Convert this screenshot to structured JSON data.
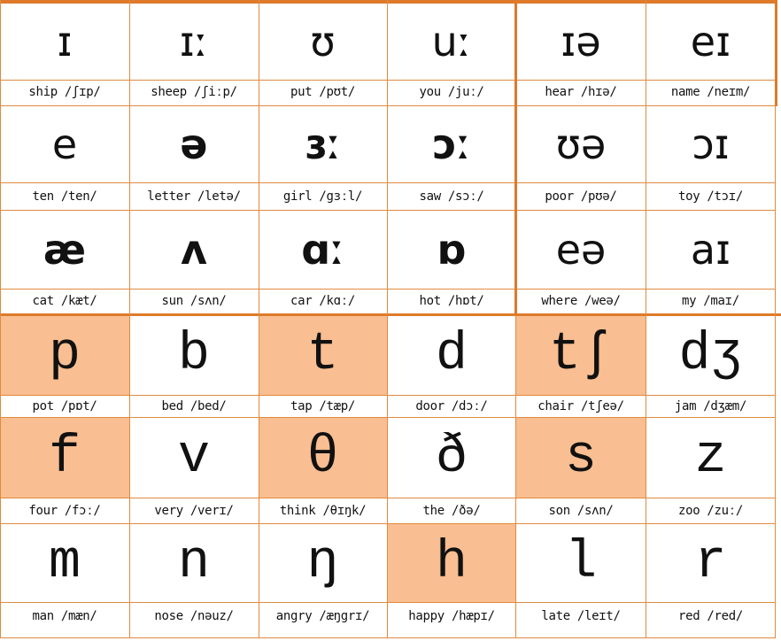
{
  "colors": {
    "grid": "#e08a40",
    "grid_thick": "#de7a2a",
    "highlight": "#f9be91",
    "text": "#111111",
    "background": "#ffffff"
  },
  "vowel_rows": [
    [
      {
        "symbol": "ɪ",
        "word": "ship",
        "ipa": "/ʃɪp/"
      },
      {
        "symbol": "ɪː",
        "word": "sheep",
        "ipa": "/ʃiːp/"
      },
      {
        "symbol": "ʊ",
        "word": "put",
        "ipa": "/pʊt/"
      },
      {
        "symbol": "uː",
        "word": "you",
        "ipa": "/juː/"
      },
      {
        "symbol": "ɪə",
        "word": "hear",
        "ipa": "/hɪə/"
      },
      {
        "symbol": "eɪ",
        "word": "name",
        "ipa": "/neɪm/"
      }
    ],
    [
      {
        "symbol": "e",
        "word": "ten",
        "ipa": "/ten/"
      },
      {
        "symbol": "ə",
        "word": "letter",
        "ipa": "/letə/"
      },
      {
        "symbol": "ɜː",
        "word": "girl",
        "ipa": "/gɜːl/"
      },
      {
        "symbol": "ɔː",
        "word": "saw",
        "ipa": "/sɔː/"
      },
      {
        "symbol": "ʊə",
        "word": "poor",
        "ipa": "/pʊə/"
      },
      {
        "symbol": "ɔɪ",
        "word": "toy",
        "ipa": "/tɔɪ/"
      }
    ],
    [
      {
        "symbol": "æ",
        "word": "cat",
        "ipa": "/kæt/"
      },
      {
        "symbol": "ʌ",
        "word": "sun",
        "ipa": "/sʌn/"
      },
      {
        "symbol": "ɑː",
        "word": "car",
        "ipa": "/kɑː/"
      },
      {
        "symbol": "ɒ",
        "word": "hot",
        "ipa": "/hɒt/"
      },
      {
        "symbol": "eə",
        "word": "where",
        "ipa": "/weə/"
      },
      {
        "symbol": "aɪ",
        "word": "my",
        "ipa": "/maɪ/"
      }
    ]
  ],
  "consonant_rows": [
    [
      {
        "symbol": "p",
        "word": "pot",
        "ipa": "/pɒt/",
        "highlight": true
      },
      {
        "symbol": "b",
        "word": "bed",
        "ipa": "/bed/",
        "highlight": false
      },
      {
        "symbol": "t",
        "word": "tap",
        "ipa": "/tæp/",
        "highlight": true
      },
      {
        "symbol": "d",
        "word": "door",
        "ipa": "/dɔː/",
        "highlight": false
      },
      {
        "symbol": "tʃ",
        "word": "chair",
        "ipa": "/tʃeə/",
        "highlight": true
      },
      {
        "symbol": "dʒ",
        "word": "jam",
        "ipa": "/dʒæm/",
        "highlight": false
      }
    ],
    [
      {
        "symbol": "f",
        "word": "four",
        "ipa": "/fɔː/",
        "highlight": true
      },
      {
        "symbol": "v",
        "word": "very",
        "ipa": "/verɪ/",
        "highlight": false
      },
      {
        "symbol": "θ",
        "word": "think",
        "ipa": "/θɪŋk/",
        "highlight": true
      },
      {
        "symbol": "ð",
        "word": "the",
        "ipa": "/ðə/",
        "highlight": false
      },
      {
        "symbol": "s",
        "word": "son",
        "ipa": "/sʌn/",
        "highlight": true
      },
      {
        "symbol": "z",
        "word": "zoo",
        "ipa": "/zuː/",
        "highlight": false
      }
    ],
    [
      {
        "symbol": "m",
        "word": "man",
        "ipa": "/mæn/",
        "highlight": false
      },
      {
        "symbol": "n",
        "word": "nose",
        "ipa": "/nəuz/",
        "highlight": false
      },
      {
        "symbol": "ŋ",
        "word": "angry",
        "ipa": "/æŋgrɪ/",
        "highlight": false
      },
      {
        "symbol": "h",
        "word": "happy",
        "ipa": "/hæpɪ/",
        "highlight": true
      },
      {
        "symbol": "l",
        "word": "late",
        "ipa": "/leɪt/",
        "highlight": false
      },
      {
        "symbol": "r",
        "word": "red",
        "ipa": "/red/",
        "highlight": false
      }
    ]
  ]
}
